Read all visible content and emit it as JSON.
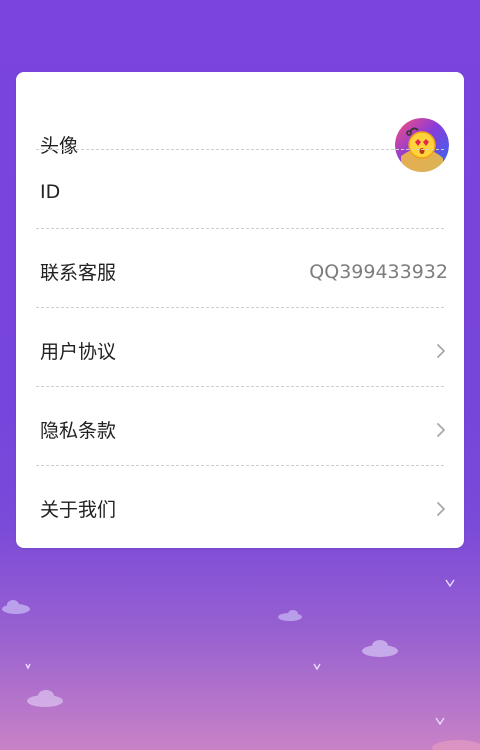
{
  "settings": {
    "rows": [
      {
        "label": "头像",
        "type": "avatar",
        "icon": "avatar-image"
      },
      {
        "label": "ID",
        "type": "plain"
      },
      {
        "label": "联系客服",
        "type": "value",
        "value": "QQ399433932"
      },
      {
        "label": "用户协议",
        "type": "link",
        "icon": "chevron-right-icon"
      },
      {
        "label": "隐私条款",
        "type": "link",
        "icon": "chevron-right-icon"
      },
      {
        "label": "关于我们",
        "type": "link",
        "icon": "chevron-right-icon"
      }
    ]
  },
  "theme": {
    "background_top": "#7a44dd",
    "background_bottom": "#c882c6",
    "card": "#ffffff",
    "label_color": "#222222",
    "value_color": "#7d7d7d",
    "chevron_color": "#a8a8a8",
    "divider_color": "#cfcfcf"
  }
}
